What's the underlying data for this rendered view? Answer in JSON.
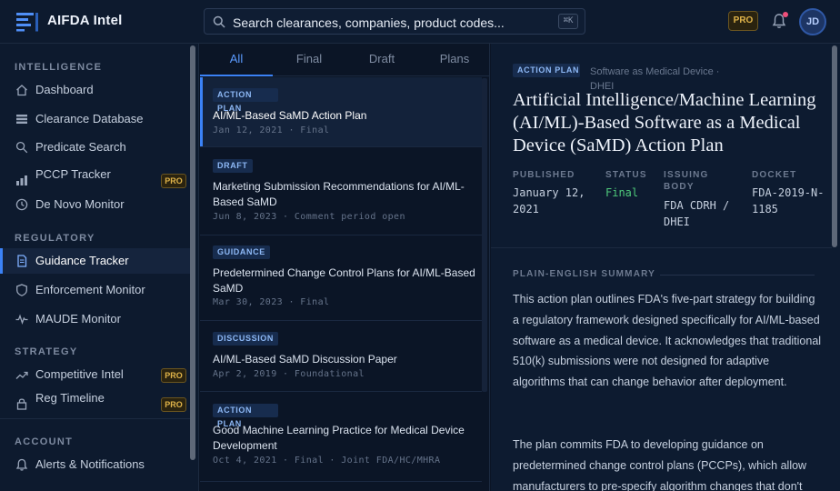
{
  "app": {
    "name": "AIFDA Intel"
  },
  "search": {
    "placeholder": "Search clearances, companies, product codes...",
    "shortcut": "⌘K"
  },
  "header": {
    "pro_label": "PRO",
    "avatar_initials": "JD"
  },
  "colors": {
    "accent": "#3b82f6",
    "pro": "#e0b44a",
    "status_final": "#4ec97a",
    "notification": "#ef4f7a"
  },
  "sidebar": {
    "sections": [
      {
        "label": "INTELLIGENCE",
        "items": [
          {
            "label": "Dashboard",
            "icon": "home-icon"
          },
          {
            "label": "Clearance Database",
            "icon": "database-icon"
          },
          {
            "label": "Predicate Search",
            "icon": "search-icon"
          },
          {
            "label": "PCCP Tracker",
            "icon": "bar-chart-icon",
            "badge": "PRO"
          },
          {
            "label": "De Novo Monitor",
            "icon": "clock-icon"
          }
        ]
      },
      {
        "label": "REGULATORY",
        "items": [
          {
            "label": "Guidance Tracker",
            "icon": "document-icon",
            "active": true
          },
          {
            "label": "Enforcement Monitor",
            "icon": "shield-icon"
          },
          {
            "label": "MAUDE Monitor",
            "icon": "pulse-icon"
          }
        ]
      },
      {
        "label": "STRATEGY",
        "items": [
          {
            "label": "Competitive Intel",
            "icon": "trend-icon",
            "badge": "PRO"
          },
          {
            "label": "Reg Timeline",
            "icon": "lock-icon",
            "badge": "PRO"
          }
        ]
      },
      {
        "label": "ACCOUNT",
        "items": [
          {
            "label": "Alerts & Notifications",
            "icon": "bell-icon"
          }
        ]
      }
    ]
  },
  "list": {
    "tabs": [
      "All",
      "Final",
      "Draft",
      "Plans"
    ],
    "active_tab": "All",
    "items": [
      {
        "tag": "ACTION PLAN",
        "title": "AI/ML-Based SaMD Action Plan",
        "meta": "Jan 12, 2021 · Final",
        "selected": true
      },
      {
        "tag": "DRAFT",
        "title": "Marketing Submission Recommendations for AI/ML-Based SaMD",
        "meta": "Jun 8, 2023 · Comment period open"
      },
      {
        "tag": "GUIDANCE",
        "title": "Predetermined Change Control Plans for AI/ML-Based SaMD",
        "meta": "Mar 30, 2023 · Final"
      },
      {
        "tag": "DISCUSSION",
        "title": "AI/ML-Based SaMD Discussion Paper",
        "meta": "Apr 2, 2019 · Foundational"
      },
      {
        "tag": "ACTION PLAN",
        "title": "Good Machine Learning Practice for Medical Device Development",
        "meta": "Oct 4, 2021 · Final · Joint FDA/HC/MHRA"
      }
    ]
  },
  "detail": {
    "tag": "ACTION PLAN",
    "breadcrumb": "Software as Medical Device · DHEI",
    "title": "Artificial Intelligence/Machine Learning (AI/ML)-Based Software as a Medical Device (SaMD) Action Plan",
    "meta": {
      "published_label": "PUBLISHED",
      "published": "January 12, 2021",
      "status_label": "STATUS",
      "status": "Final",
      "body_label": "ISSUING BODY",
      "body": "FDA CDRH / DHEI",
      "docket_label": "DOCKET",
      "docket": "FDA-2019-N-1185"
    },
    "summary_label": "PLAIN-ENGLISH SUMMARY",
    "paragraphs": [
      "This action plan outlines FDA's five-part strategy for building a regulatory framework designed specifically for AI/ML-based software as a medical device. It acknowledges that traditional 510(k) submissions were not designed for adaptive algorithms that can change behavior after deployment.",
      "The plan commits FDA to developing guidance on predetermined change control plans (PCCPs), which allow manufacturers to pre-specify algorithm changes that don't"
    ]
  }
}
